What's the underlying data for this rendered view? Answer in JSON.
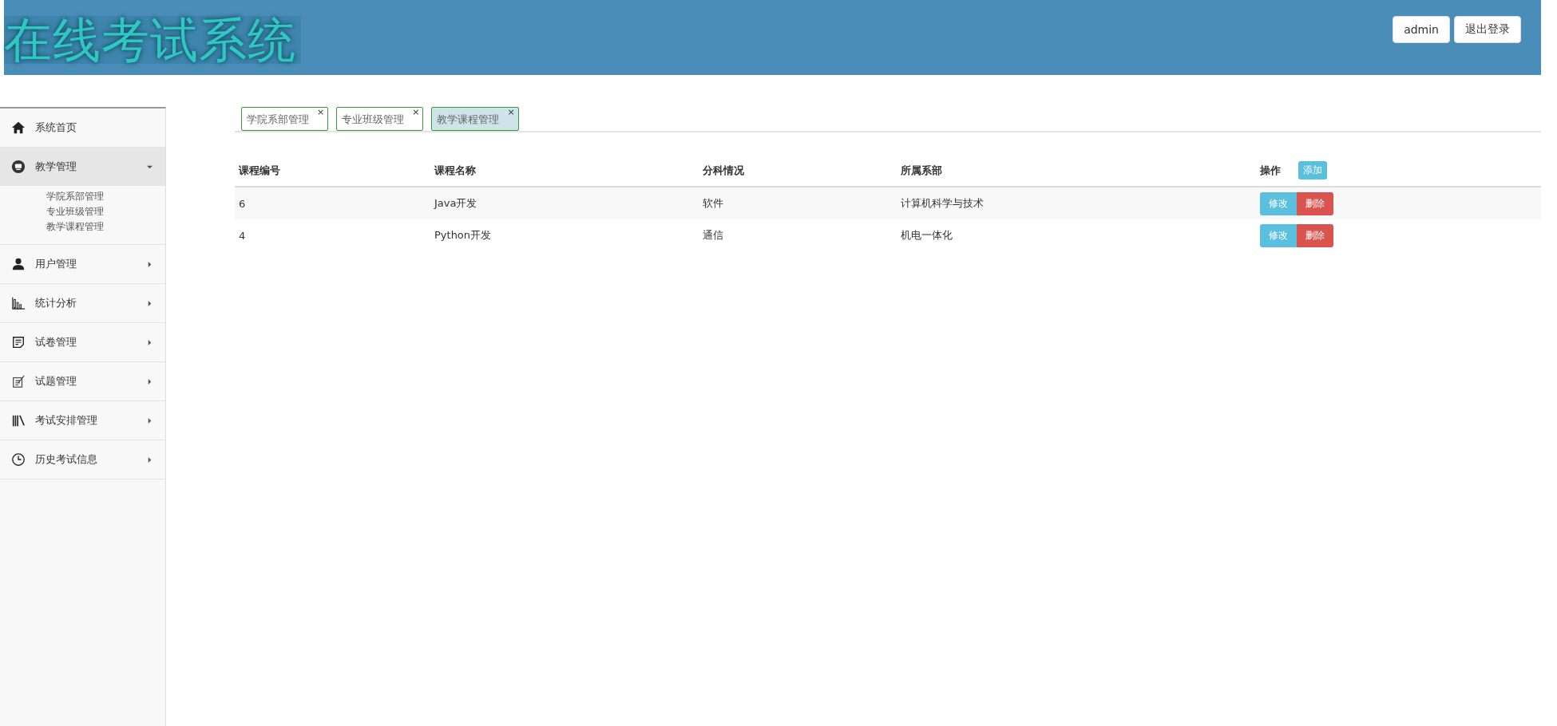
{
  "header": {
    "title": "在线考试系统",
    "user_button": "admin",
    "logout_button": "退出登录"
  },
  "sidebar": {
    "items": [
      {
        "label": "系统首页",
        "has_arrow": false,
        "expanded": false
      },
      {
        "label": "教学管理",
        "has_arrow": true,
        "expanded": true,
        "children": [
          {
            "label": "学院系部管理"
          },
          {
            "label": "专业班级管理"
          },
          {
            "label": "教学课程管理"
          }
        ]
      },
      {
        "label": "用户管理",
        "has_arrow": true,
        "expanded": false
      },
      {
        "label": "统计分析",
        "has_arrow": true,
        "expanded": false
      },
      {
        "label": "试卷管理",
        "has_arrow": true,
        "expanded": false
      },
      {
        "label": "试题管理",
        "has_arrow": true,
        "expanded": false
      },
      {
        "label": "考试安排管理",
        "has_arrow": true,
        "expanded": false
      },
      {
        "label": "历史考试信息",
        "has_arrow": true,
        "expanded": false
      }
    ]
  },
  "tabs": [
    {
      "label": "学院系部管理",
      "close": "×",
      "selected": false
    },
    {
      "label": "专业班级管理",
      "close": "×",
      "selected": false
    },
    {
      "label": "教学课程管理",
      "close": "×",
      "selected": true
    }
  ],
  "table": {
    "columns": [
      "课程编号",
      "课程名称",
      "分科情况",
      "所属系部",
      "操作"
    ],
    "add_button": "添加",
    "rows": [
      {
        "cells": [
          "6",
          "Java开发",
          "软件",
          "计算机科学与技术"
        ],
        "edit": "修改",
        "delete": "删除"
      },
      {
        "cells": [
          "4",
          "Python开发",
          "通信",
          "机电一体化"
        ],
        "edit": "修改",
        "delete": "删除"
      }
    ]
  }
}
